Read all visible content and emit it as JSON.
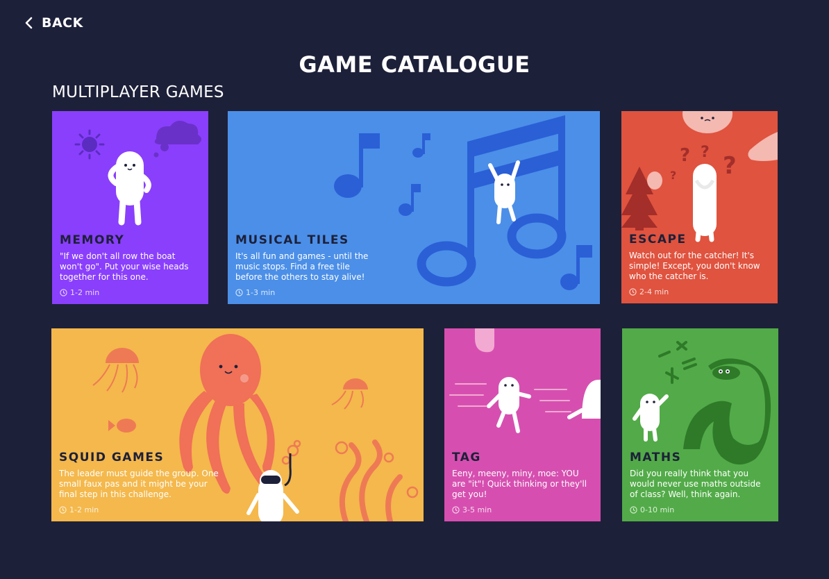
{
  "nav": {
    "back_label": "BACK"
  },
  "page": {
    "title": "GAME CATALOGUE"
  },
  "section": {
    "title": "MULTIPLAYER GAMES"
  },
  "games": [
    {
      "name": "MEMORY",
      "description": "\"If we don't all row the boat won't go\". Put your wise heads together for this one.",
      "duration": "1-2 min",
      "color": "#8a3ffc"
    },
    {
      "name": "MUSICAL TILES",
      "description": "It's all fun and games - until the music stops. Find a free tile before the others to stay alive!",
      "duration": "1-3 min",
      "color": "#4b8fe8"
    },
    {
      "name": "ESCAPE",
      "description": "Watch out for the catcher! It's simple! Except, you don't know who the catcher is.",
      "duration": "2-4 min",
      "color": "#e0533f"
    },
    {
      "name": "SQUID GAMES",
      "description": "The leader must guide the group. One small faux pas and it might be your final step in this challenge.",
      "duration": "1-2 min",
      "color": "#f4b84c"
    },
    {
      "name": "TAG",
      "description": "Eeny, meeny, miny, moe: YOU are \"it\"! Quick thinking or they'll get you!",
      "duration": "3-5 min",
      "color": "#d64fb0"
    },
    {
      "name": "MATHS",
      "description": "Did you really think that you would never use maths outside of class? Well, think again.",
      "duration": "0-10 min",
      "color": "#52ab48"
    }
  ]
}
